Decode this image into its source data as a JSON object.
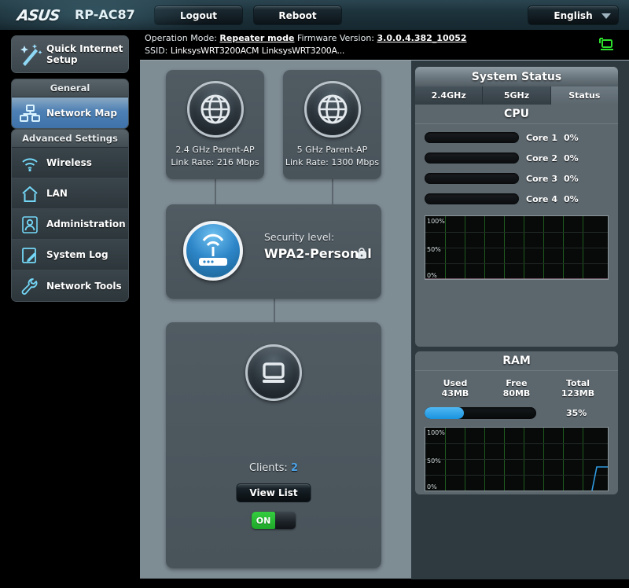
{
  "header": {
    "brand": "ASUS",
    "model": "RP-AC87",
    "logout_label": "Logout",
    "reboot_label": "Reboot",
    "language": "English"
  },
  "infobar": {
    "operation_mode_label": "Operation Mode:",
    "operation_mode_value": "Repeater mode",
    "firmware_label": "Firmware Version:",
    "firmware_value": "3.0.0.4.382_10052",
    "ssid_label": "SSID:",
    "ssid_value_1": "LinksysWRT3200ACM",
    "ssid_value_2": "LinksysWRT3200A..."
  },
  "sidebar": {
    "quick_setup": "Quick Internet Setup",
    "general_header": "General",
    "general_items": [
      {
        "label": "Network Map",
        "icon": "network-map-icon",
        "active": true
      }
    ],
    "advanced_header": "Advanced Settings",
    "advanced_items": [
      {
        "label": "Wireless",
        "icon": "wifi-icon"
      },
      {
        "label": "LAN",
        "icon": "home-icon"
      },
      {
        "label": "Administration",
        "icon": "user-icon"
      },
      {
        "label": "System Log",
        "icon": "log-icon"
      },
      {
        "label": "Network Tools",
        "icon": "wrench-icon"
      }
    ]
  },
  "network_map": {
    "parent_ap_24": {
      "title": "2.4 GHz Parent-AP",
      "link_rate": "Link Rate: 216 Mbps"
    },
    "parent_ap_5": {
      "title": "5 GHz Parent-AP",
      "link_rate": "Link Rate: 1300 Mbps"
    },
    "security": {
      "label": "Security level:",
      "value": "WPA2-Personal"
    },
    "clients": {
      "label": "Clients:",
      "count": "2",
      "view_list": "View List",
      "toggle_state": "ON"
    }
  },
  "system_status": {
    "title": "System Status",
    "tabs": [
      {
        "label": "2.4GHz",
        "active": false
      },
      {
        "label": "5GHz",
        "active": false
      },
      {
        "label": "Status",
        "active": true
      }
    ],
    "cpu": {
      "title": "CPU",
      "cores": [
        {
          "name": "Core 1",
          "percent": "0%",
          "value": 0
        },
        {
          "name": "Core 2",
          "percent": "0%",
          "value": 0
        },
        {
          "name": "Core 3",
          "percent": "0%",
          "value": 0
        },
        {
          "name": "Core 4",
          "percent": "0%",
          "value": 0
        }
      ],
      "graph_labels": {
        "top": "100%",
        "mid": "50%",
        "bottom": "0%"
      }
    },
    "ram": {
      "title": "RAM",
      "used_label": "Used",
      "used_value": "43MB",
      "free_label": "Free",
      "free_value": "80MB",
      "total_label": "Total",
      "total_value": "123MB",
      "percent": "35%",
      "graph_labels": {
        "top": "100%",
        "mid": "50%",
        "bottom": "0%"
      }
    }
  },
  "colors": {
    "accent_blue": "#4da3e8",
    "toggle_green": "#24b52f",
    "panel_gray": "#7e8c94",
    "status_dark": "#2e3940"
  }
}
